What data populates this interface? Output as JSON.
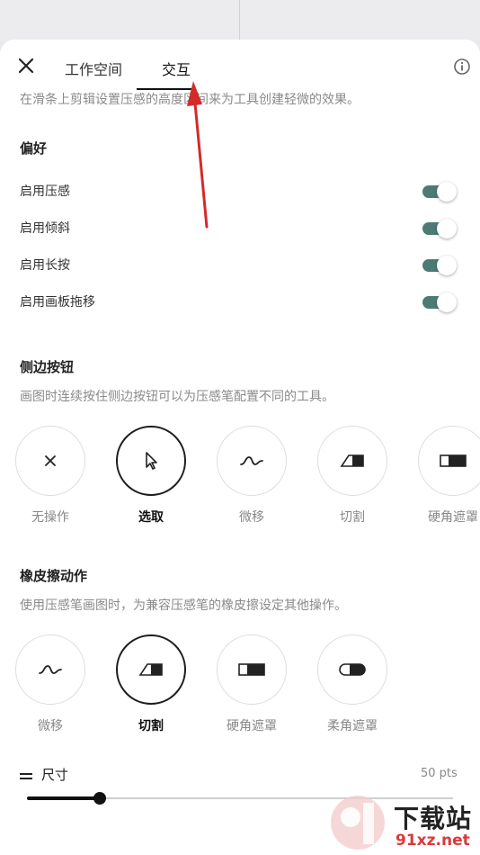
{
  "header": {
    "tabs": [
      {
        "label": "工作空间",
        "active": false
      },
      {
        "label": "交互",
        "active": true
      }
    ]
  },
  "intro_text": "在滑条上剪辑设置压感的高度区间来为工具创建轻微的效果。",
  "preferences": {
    "title": "偏好",
    "items": [
      {
        "label": "启用压感",
        "on": true
      },
      {
        "label": "启用倾斜",
        "on": true
      },
      {
        "label": "启用长按",
        "on": true
      },
      {
        "label": "启用画板拖移",
        "on": true
      }
    ]
  },
  "side_button": {
    "title": "侧边按钮",
    "description": "画图时连续按住侧边按钮可以为压感笔配置不同的工具。",
    "options": [
      {
        "label": "无操作",
        "icon": "x-icon",
        "selected": false
      },
      {
        "label": "选取",
        "icon": "pointer-icon",
        "selected": true
      },
      {
        "label": "微移",
        "icon": "wave-icon",
        "selected": false
      },
      {
        "label": "切割",
        "icon": "eraser-wedge-icon",
        "selected": false
      },
      {
        "label": "硬角遮罩",
        "icon": "hard-mask-icon",
        "selected": false
      }
    ]
  },
  "eraser_action": {
    "title": "橡皮擦动作",
    "description": "使用压感笔画图时，为兼容压感笔的橡皮擦设定其他操作。",
    "options": [
      {
        "label": "微移",
        "icon": "wave-icon",
        "selected": false
      },
      {
        "label": "切割",
        "icon": "eraser-wedge-icon",
        "selected": true
      },
      {
        "label": "硬角遮罩",
        "icon": "hard-mask-icon",
        "selected": false
      },
      {
        "label": "柔角遮罩",
        "icon": "soft-mask-icon",
        "selected": false
      }
    ]
  },
  "size": {
    "label": "尺寸",
    "value_text": "50 pts",
    "fraction": 0.17
  },
  "watermark": {
    "text": "下载站",
    "sub": "91xz.net"
  },
  "colors": {
    "toggle_on": "#4c7b74",
    "arrow": "#d42a2a"
  }
}
